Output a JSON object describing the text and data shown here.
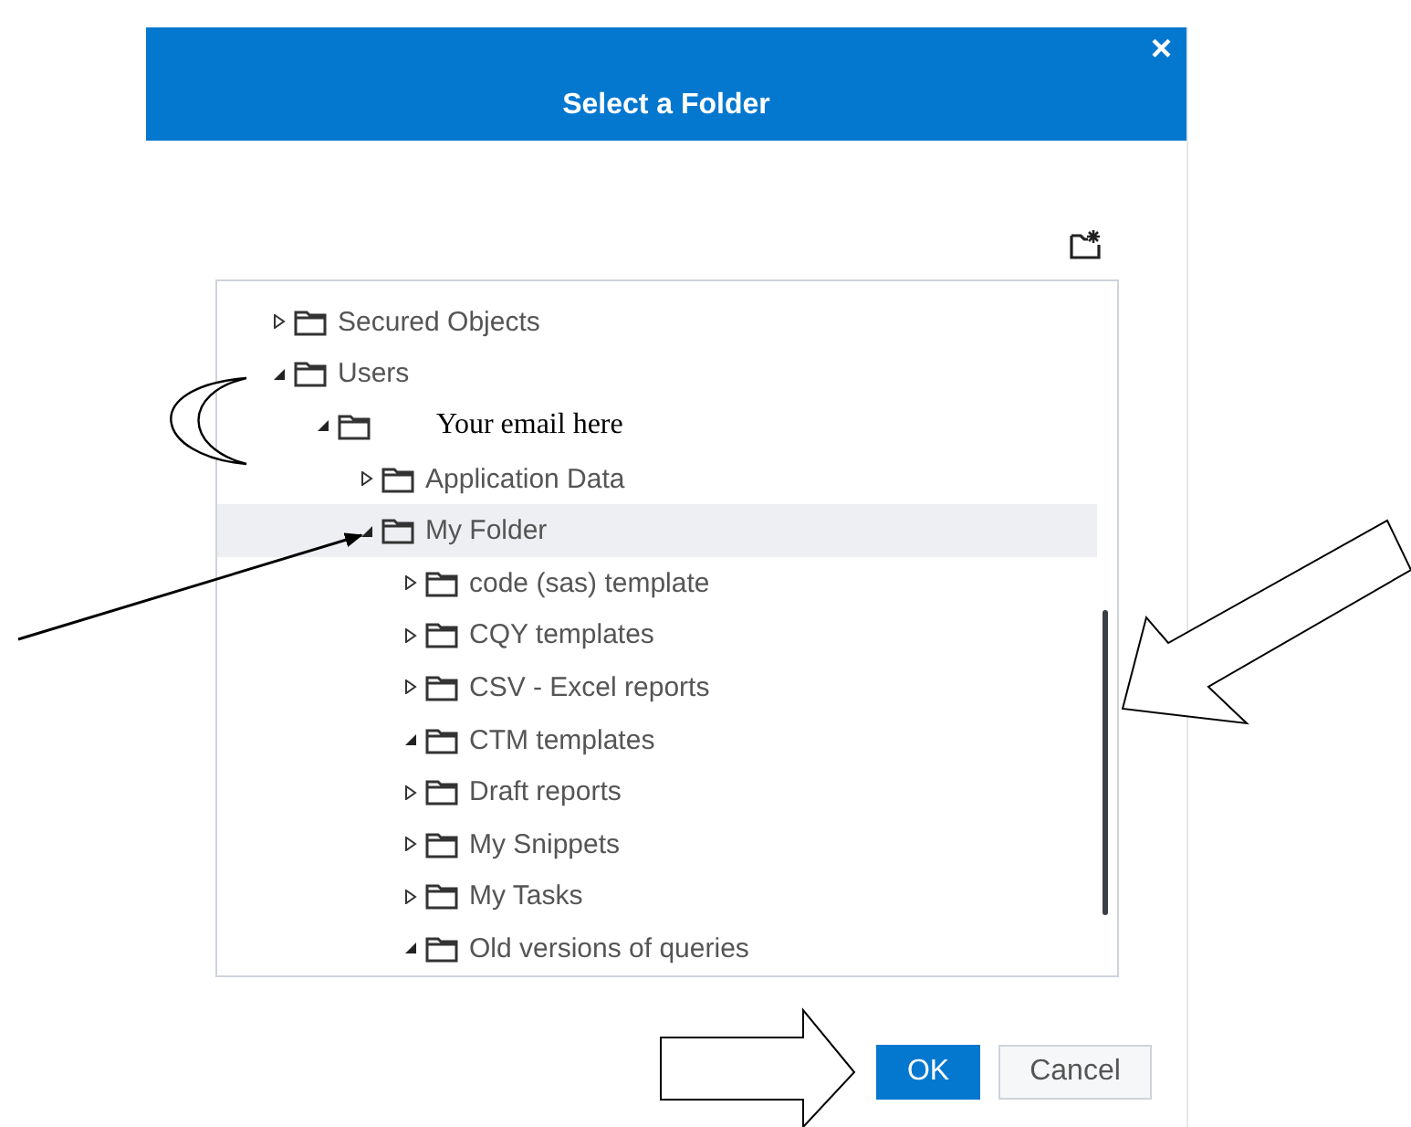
{
  "dialog": {
    "title": "Select a Folder",
    "close": "×",
    "tree": [
      {
        "label": "Secured Objects",
        "kind": "folder",
        "expanded": false,
        "selected": false
      },
      {
        "label": "Users",
        "kind": "folder",
        "expanded": true,
        "selected": false,
        "children": [
          {
            "label": "Your email here",
            "kind": "annotated",
            "expanded": true,
            "selected": false,
            "children": [
              {
                "label": "Application Data",
                "kind": "folder",
                "expanded": false,
                "selected": false
              },
              {
                "label": "My Folder",
                "kind": "folder",
                "expanded": true,
                "selected": true,
                "children": [
                  {
                    "label": "code (sas) template",
                    "kind": "folder",
                    "expanded": false,
                    "selected": false
                  },
                  {
                    "label": "CQY templates",
                    "kind": "folder",
                    "expanded": false,
                    "selected": false
                  },
                  {
                    "label": "CSV - Excel reports",
                    "kind": "folder",
                    "expanded": false,
                    "selected": false
                  },
                  {
                    "label": "CTM templates",
                    "kind": "folder",
                    "expanded": true,
                    "selected": false
                  },
                  {
                    "label": "Draft reports",
                    "kind": "folder",
                    "expanded": false,
                    "selected": false
                  },
                  {
                    "label": "My Snippets",
                    "kind": "folder",
                    "expanded": false,
                    "selected": false
                  },
                  {
                    "label": "My Tasks",
                    "kind": "folder",
                    "expanded": false,
                    "selected": false
                  },
                  {
                    "label": "Old versions of queries",
                    "kind": "folder",
                    "expanded": true,
                    "selected": false
                  }
                ]
              }
            ]
          }
        ]
      }
    ],
    "buttons": [
      {
        "label": "OK",
        "kind": "primary"
      },
      {
        "label": "Cancel",
        "kind": "secondary"
      }
    ]
  }
}
